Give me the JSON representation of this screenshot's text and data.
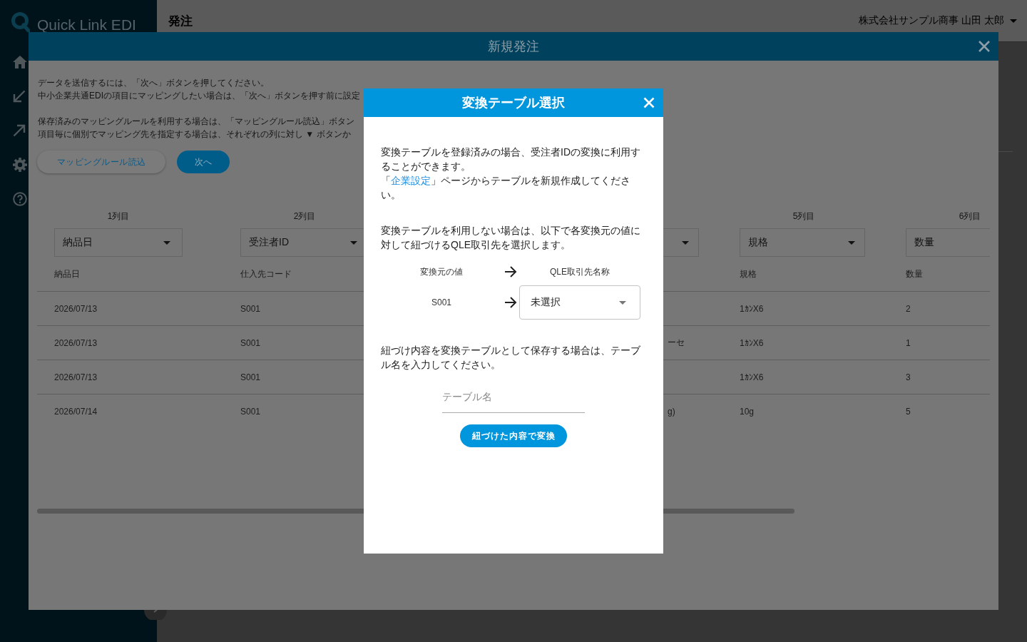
{
  "sidebar": {
    "logo": "Quick Link EDI"
  },
  "header": {
    "title": "発注",
    "user": "株式会社サンプル商事 山田 太郎"
  },
  "order_dialog": {
    "title": "新規発注",
    "instructions": [
      [
        "データを送信するには、「次へ」ボタンを押してください。",
        "中小企業共通EDIの項目にマッピングしたい場合は、「次へ」ボタンを押す前に設定"
      ],
      [
        "保存済みのマッピングルールを利用する場合は、「マッピングルール読込」ボタン",
        "項目毎に個別でマッピング先を指定する場合は、それぞれの列に対し ▼ ボタンか"
      ]
    ],
    "buttons": [
      {
        "label": "マッピングルール読込",
        "kind": "secondary"
      },
      {
        "label": "次へ",
        "kind": "primary"
      }
    ],
    "table": {
      "columns": {
        "column_1": {
          "label": "1列目",
          "mapping": "納品日",
          "caret": true,
          "heading": "納品日"
        },
        "column_2": {
          "label": "2列目",
          "mapping": "受注者ID",
          "caret": true,
          "heading": "仕入先コード"
        },
        "column_4": {
          "caret": true
        },
        "column_5": {
          "label": "5列目",
          "mapping": "規格",
          "caret": true,
          "heading": "規格"
        },
        "column_6": {
          "label": "6列目",
          "mapping": "数量",
          "caret": false,
          "heading": "数量"
        }
      },
      "rows": [
        {
          "column_1": "2026/07/13",
          "column_2": "S001",
          "column_5": "1ｶﾝX6",
          "column_6": "2"
        },
        {
          "column_1": "2026/07/13",
          "column_2": "S001",
          "column_4": "ーセ",
          "column_5": "1ｶﾝX6",
          "column_6": "1"
        },
        {
          "column_1": "2026/07/13",
          "column_2": "S001",
          "column_5": "1ｶﾝX6",
          "column_6": "3"
        },
        {
          "column_1": "2026/07/14",
          "column_2": "S001",
          "column_4": "g)",
          "column_5": "10g",
          "column_6": "5"
        }
      ]
    }
  },
  "conversion_dialog": {
    "title": "変換テーブル選択",
    "intro": "変換テーブルを登録済みの場合、受注者IDの変換に利用することができます。",
    "settings_note": {
      "before": "「",
      "link": "企業設定",
      "after": "」ページからテーブルを新規作成してください。"
    },
    "mapping_note": "変換テーブルを利用しない場合は、以下で各変換元の値に対して紐づけるQLE取引先を選択します。",
    "mapping": {
      "source_heading": "変換元の値",
      "target_heading": "QLE取引先名称",
      "rows": [
        {
          "source": "S001",
          "target": "未選択"
        }
      ]
    },
    "save_note": "紐づけ内容を変換テーブルとして保存する場合は、テーブル名を入力してください。",
    "table_name": {
      "placeholder": "テーブル名"
    },
    "convert_button": "紐づけた内容で変換"
  }
}
